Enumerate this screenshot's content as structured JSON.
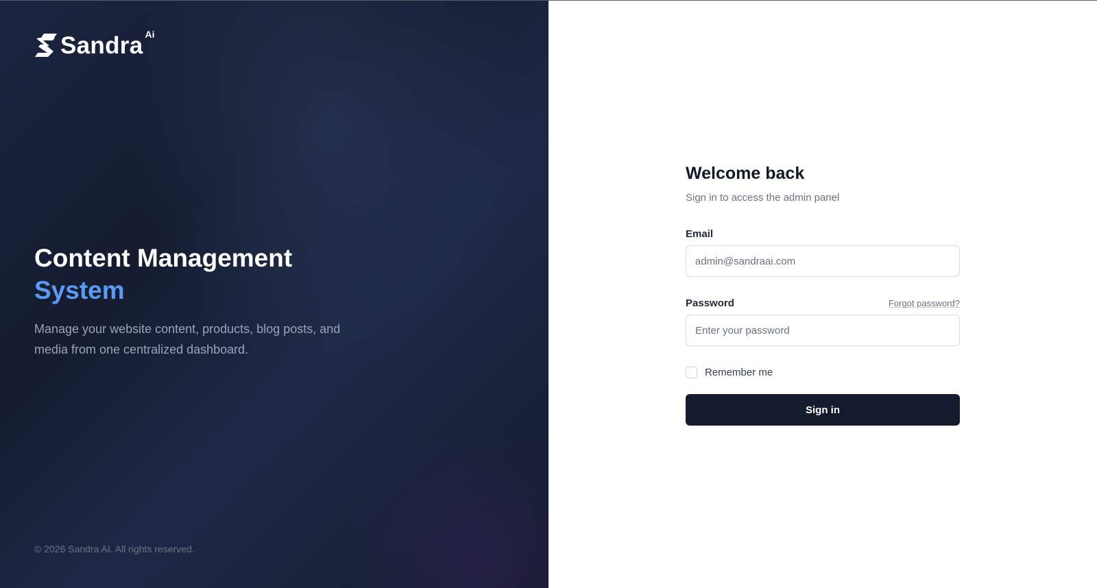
{
  "brand": {
    "logo_icon": "sandra-s-logo-icon",
    "name": "Sandra",
    "superscript": "Ai"
  },
  "hero": {
    "title": "Content Management",
    "title_accent": "System",
    "description": "Manage your website content, products, blog posts, and media from one centralized dashboard."
  },
  "footer": {
    "copyright": "© 2026 Sandra AI. All rights reserved."
  },
  "login": {
    "title": "Welcome back",
    "subtitle": "Sign in to access the admin panel",
    "email_label": "Email",
    "email_placeholder": "admin@sandraai.com",
    "password_label": "Password",
    "forgot_password": "Forgot password?",
    "password_placeholder": "Enter your password",
    "remember_label": "Remember me",
    "remember_checked": false,
    "submit_label": "Sign in"
  },
  "colors": {
    "accent": "#5a9cf4",
    "panel_dark": "#151c30",
    "button": "#141b2d"
  }
}
